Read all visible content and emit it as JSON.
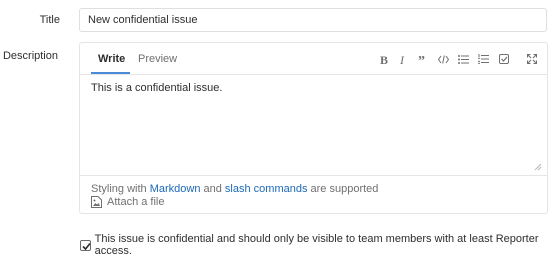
{
  "title_field": {
    "label": "Title",
    "value": "New confidential issue"
  },
  "description": {
    "label": "Description",
    "tabs": {
      "write": "Write",
      "preview": "Preview"
    },
    "toolbar": [
      "bold-icon",
      "italic-icon",
      "quote-icon",
      "code-icon",
      "bulleted-list-icon",
      "numbered-list-icon",
      "task-list-icon",
      "fullscreen-icon"
    ],
    "body_text": "This is a confidential issue.",
    "footer": {
      "prefix": "Styling with ",
      "markdown_link": "Markdown",
      "middle": " and ",
      "slash_link": "slash commands",
      "suffix": " are supported",
      "attach": "Attach a file"
    }
  },
  "confidential": {
    "checked": true,
    "label": "This issue is confidential and should only be visible to team members with at least Reporter access."
  },
  "colors": {
    "link": "#1b69b6",
    "tab_underline": "#4b8ad6",
    "muted_text": "#707070"
  }
}
